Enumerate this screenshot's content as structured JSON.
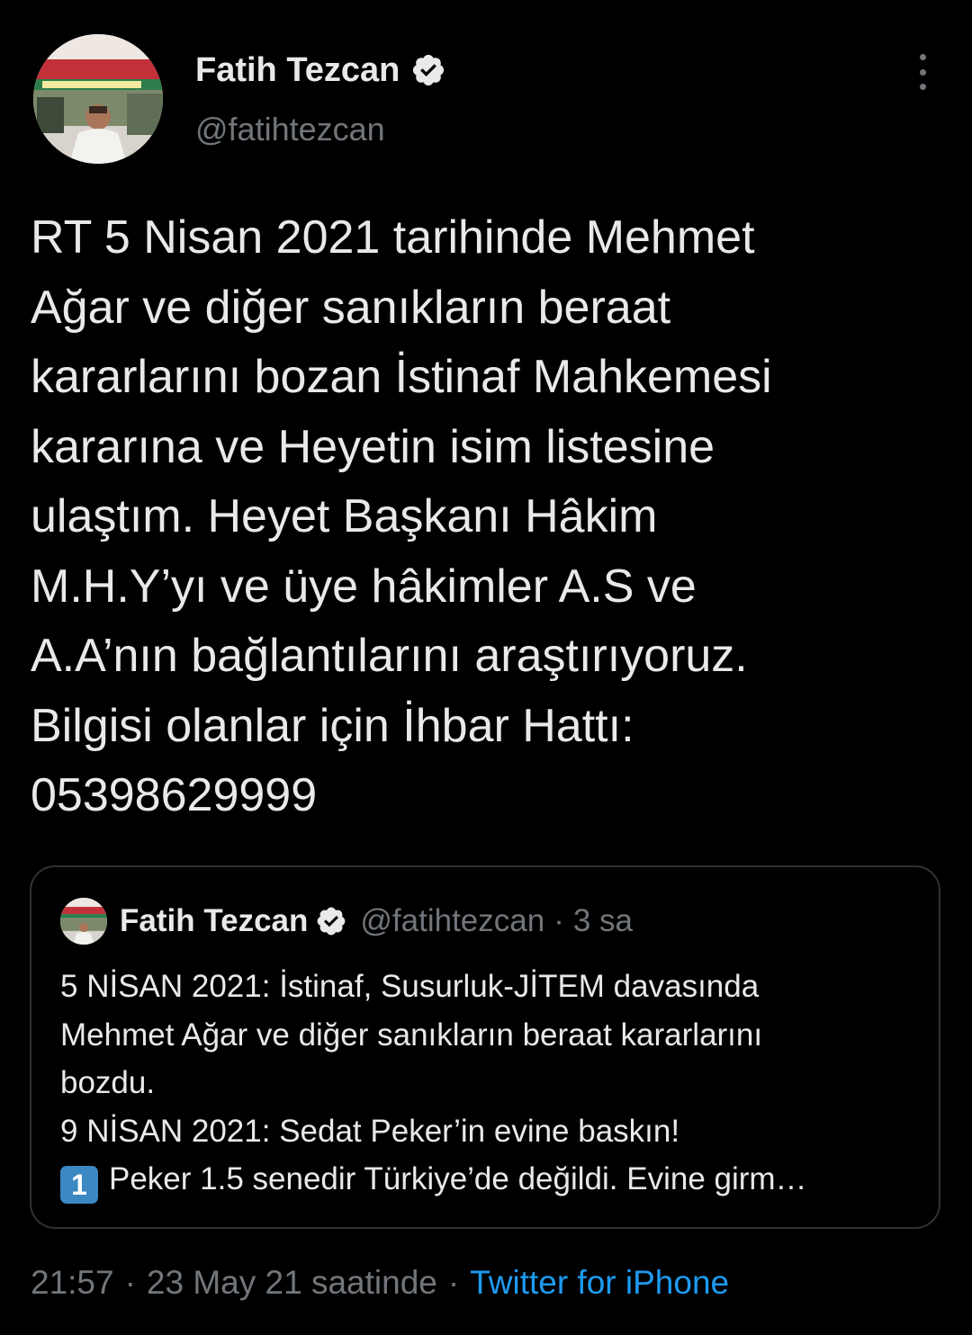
{
  "author": {
    "display_name": "Fatih Tezcan",
    "handle": "@fatihtezcan",
    "avatar_icon": "profile-photo",
    "verified_icon": "verified-badge-icon"
  },
  "tweet": {
    "text": "RT 5 Nisan 2021 tarihinde Mehmet\nAğar ve diğer sanıkların beraat\nkararlarını bozan İstinaf Mahkemesi\nkararına ve Heyetin isim listesine\nulaştım. Heyet Başkanı Hâkim\nM.H.Y’yı ve üye hâkimler A.S ve\nA.A’nın bağlantılarını araştırıyoruz.\nBilgisi olanlar için İhbar Hattı:\n05398629999"
  },
  "quoted_tweet": {
    "display_name": "Fatih Tezcan",
    "handle": "@fatihtezcan",
    "separator": "·",
    "time": "3 sa",
    "lines": [
      "5 NİSAN 2021: İstinaf, Susurluk-JİTEM davasında",
      "Mehmet Ağar ve diğer sanıkların beraat kararlarını",
      "bozdu.",
      "9 NİSAN 2021: Sedat Peker’in evine baskın!"
    ],
    "last_line_emoji": "1",
    "last_line_text": "Peker 1.5 senedir Türkiye’de değildi. Evine girm…"
  },
  "footer": {
    "time": "21:57",
    "dot1": "·",
    "date": "23 May 21 saatinde",
    "dot2": "·",
    "source": "Twitter for iPhone"
  },
  "colors": {
    "background": "#000000",
    "primary_text": "#e7e9ea",
    "secondary_text": "#71767b",
    "link": "#1d9bf0",
    "border": "#2f3336",
    "keycap": "#3b88c3"
  }
}
